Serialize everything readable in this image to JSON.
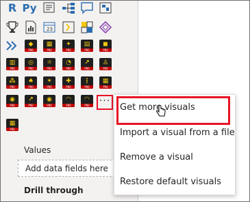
{
  "visualizations_pane": {
    "standard_icons": [
      {
        "name": "r-script-visual",
        "glyph": "R",
        "color": "#2b6cb0"
      },
      {
        "name": "python-visual",
        "glyph": "Py",
        "color": "#2b6cb0"
      },
      {
        "name": "smart-narrative",
        "glyph": "≡",
        "color": "#3a3a3a"
      },
      {
        "name": "decomposition-tree",
        "glyph": "⊞",
        "color": "#2b6cb0"
      },
      {
        "name": "qa-visual",
        "glyph": "☐",
        "color": "#2b6cb0"
      },
      {
        "name": "key-influencers",
        "glyph": "▣",
        "color": "#3a3a3a"
      }
    ],
    "more_button_label": "···",
    "values_label": "Values",
    "add_fields_placeholder": "Add data fields here",
    "drill_through_label": "Drill through"
  },
  "context_menu": {
    "items": [
      "Get more visuals",
      "Import a visual from a file",
      "Remove a visual",
      "Restore default visuals"
    ]
  },
  "colors": {
    "highlight_red": "#e81123",
    "custom_icon_bg": "#1f1f1f",
    "custom_icon_accent": "#f2c811",
    "pro_badge": "#c00000"
  }
}
